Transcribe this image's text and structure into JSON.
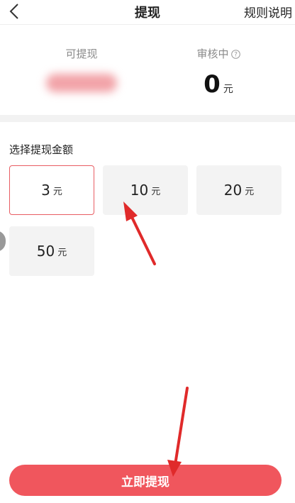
{
  "header": {
    "title": "提现",
    "rules_label": "规则说明"
  },
  "summary": {
    "available_label": "可提现",
    "pending_label": "审核中",
    "pending_amount": "0",
    "currency_unit": "元"
  },
  "section": {
    "label": "选择提现金额"
  },
  "options": [
    {
      "value": "3",
      "unit": "元",
      "selected": true
    },
    {
      "value": "10",
      "unit": "元",
      "selected": false
    },
    {
      "value": "20",
      "unit": "元",
      "selected": false
    },
    {
      "value": "50",
      "unit": "元",
      "selected": false
    }
  ],
  "action": {
    "withdraw_label": "立即提现"
  },
  "colors": {
    "accent": "#f0565d",
    "selected_border": "#e85d63",
    "annotation_arrow": "#e02a2a"
  }
}
